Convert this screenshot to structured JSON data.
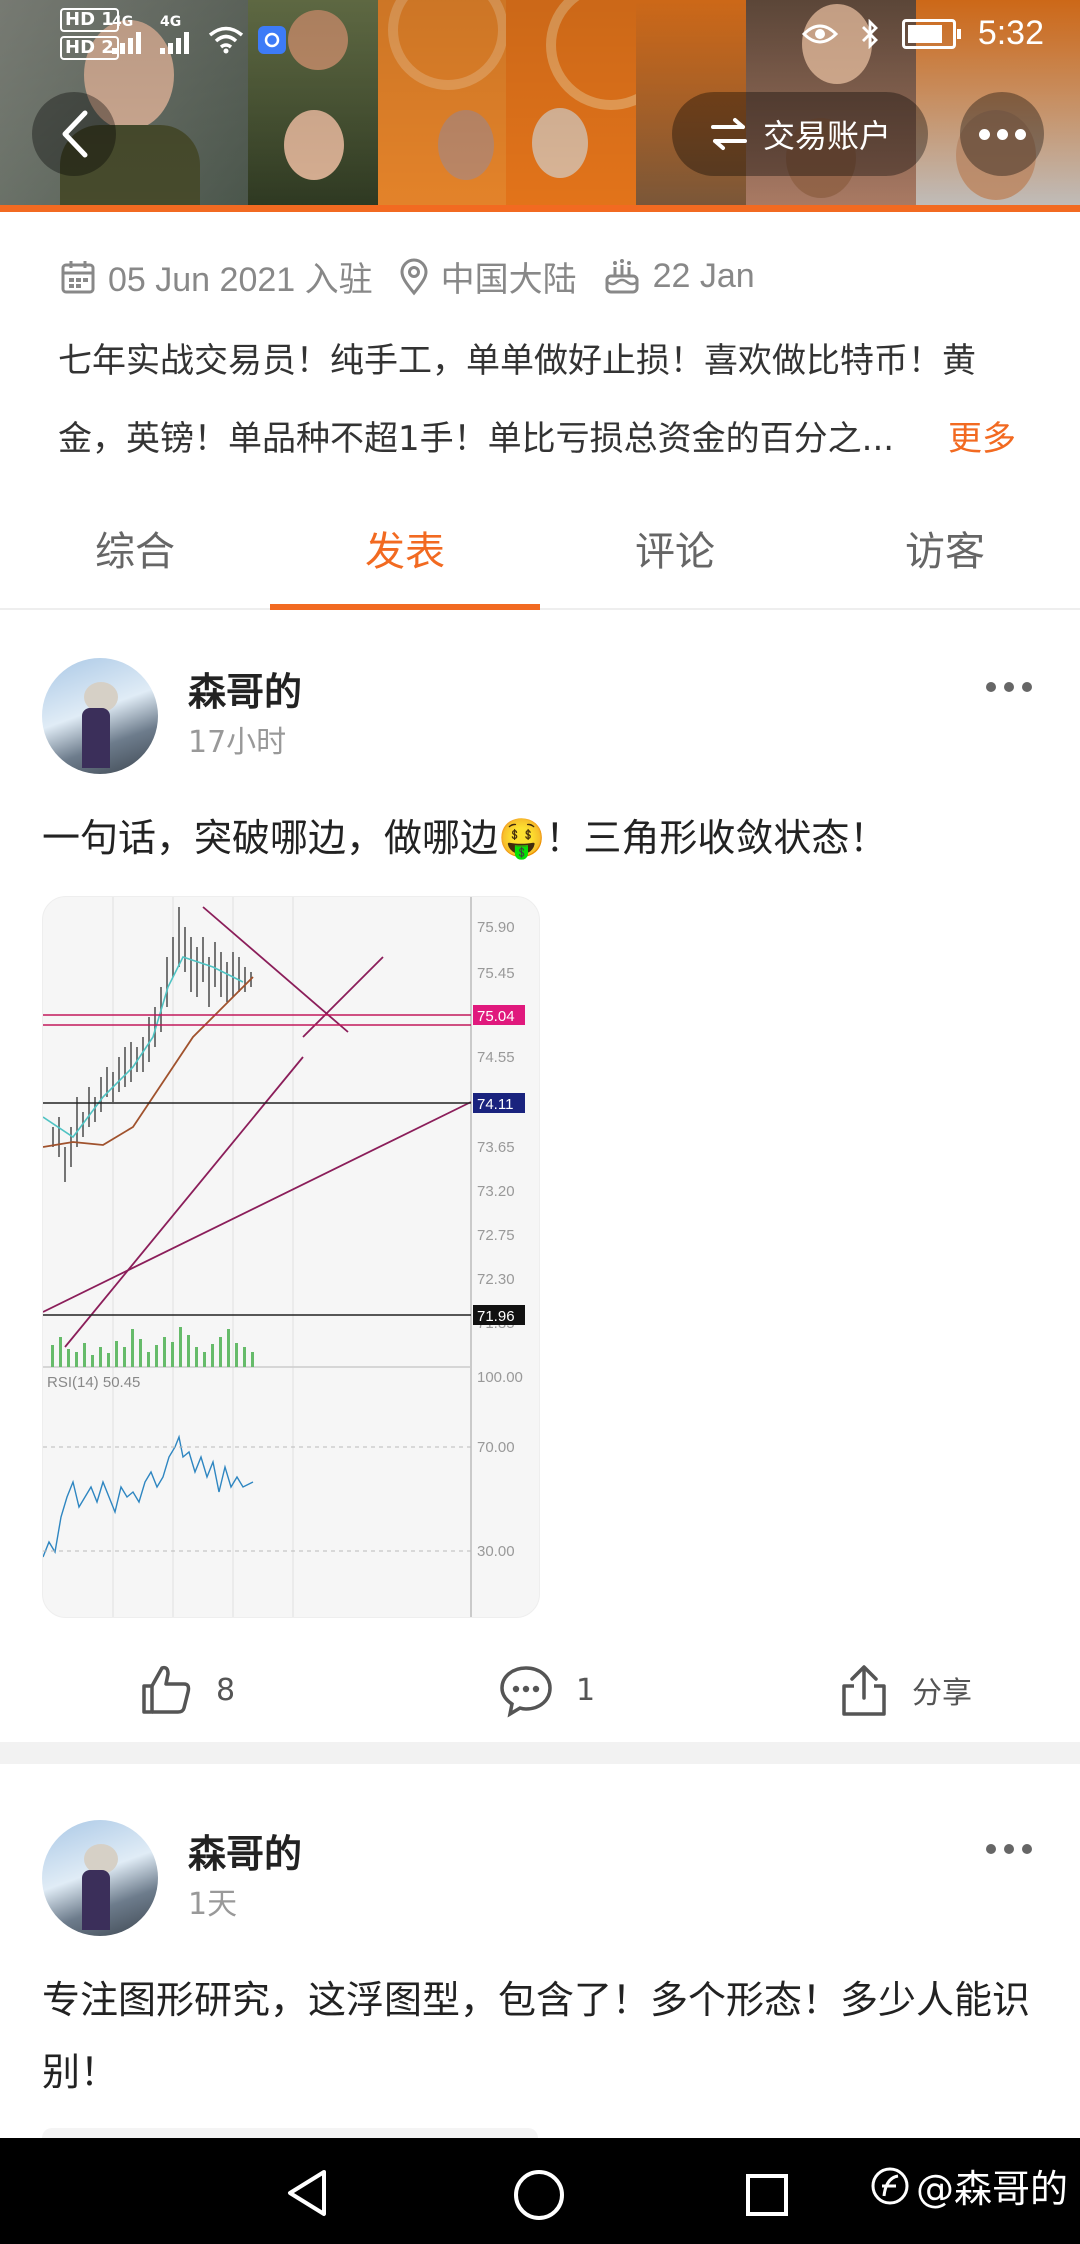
{
  "status_bar": {
    "time": "5:32",
    "hd1": "HD 1",
    "hd2": "HD 2",
    "net1": "4G",
    "net2": "4G"
  },
  "header": {
    "switch_label": "交易账户"
  },
  "profile": {
    "joined": "05 Jun 2021 入驻",
    "location": "中国大陆",
    "birthday": "22 Jan",
    "bio": "七年实战交易员！纯手工，单单做好止损！喜欢做比特币！黄金，英镑！单品种不超1手！单比亏损总资金的百分之...",
    "more_label": "更多"
  },
  "tabs": [
    {
      "label": "综合",
      "active": false
    },
    {
      "label": "发表",
      "active": true
    },
    {
      "label": "评论",
      "active": false
    },
    {
      "label": "访客",
      "active": false
    }
  ],
  "posts": [
    {
      "author": "森哥的",
      "time": "17小时",
      "text": "一句话，突破哪边，做哪边🤑！三角形收敛状态！",
      "likes": "8",
      "comments": "1",
      "share_label": "分享"
    },
    {
      "author": "森哥的",
      "time": "1天",
      "text": "专注图形研究，这浮图型，包含了！多个形态！多少人能识别！"
    }
  ],
  "chart_data": {
    "type": "line",
    "title": "",
    "price_ticks": [
      "75.90",
      "75.45",
      "74.55",
      "73.65",
      "73.20",
      "72.75",
      "72.30",
      "71.85"
    ],
    "price_labels": [
      {
        "value": "75.04",
        "color": "#e0197d"
      },
      {
        "value": "74.11",
        "color": "#1a237e"
      },
      {
        "value": "71.96",
        "color": "#111111"
      }
    ],
    "indicator_label": "RSI(14) 50.45",
    "rsi_ticks": [
      "100.00",
      "70.00",
      "30.00"
    ],
    "ylim": [
      71.85,
      75.9
    ]
  },
  "nav": {
    "watermark": "@森哥的"
  },
  "colors": {
    "accent": "#f26a21"
  }
}
